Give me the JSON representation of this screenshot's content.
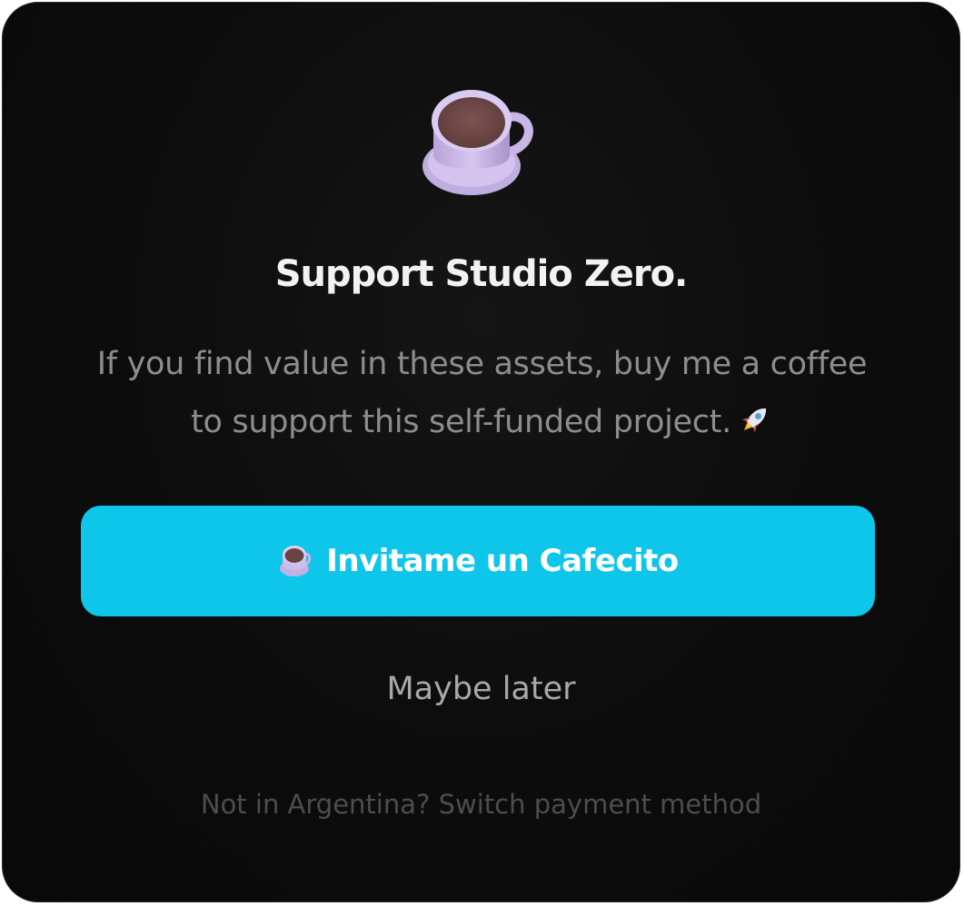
{
  "dialog": {
    "icon": "coffee-cup-icon",
    "title": "Support Studio Zero.",
    "description": "If you find value in these assets, buy me a coffee to support this self-funded project.",
    "description_icon": "rocket-icon",
    "primary_button": {
      "icon": "coffee-cup-icon",
      "label": "Invitame un Cafecito",
      "color": "#0ec5ea"
    },
    "secondary_link": "Maybe later",
    "footer_link": "Not in Argentina? Switch payment method"
  },
  "colors": {
    "background": "#0c0c0c",
    "accent": "#0ec5ea",
    "cup_body": "#c9b6e6",
    "coffee": "#6e4746"
  }
}
